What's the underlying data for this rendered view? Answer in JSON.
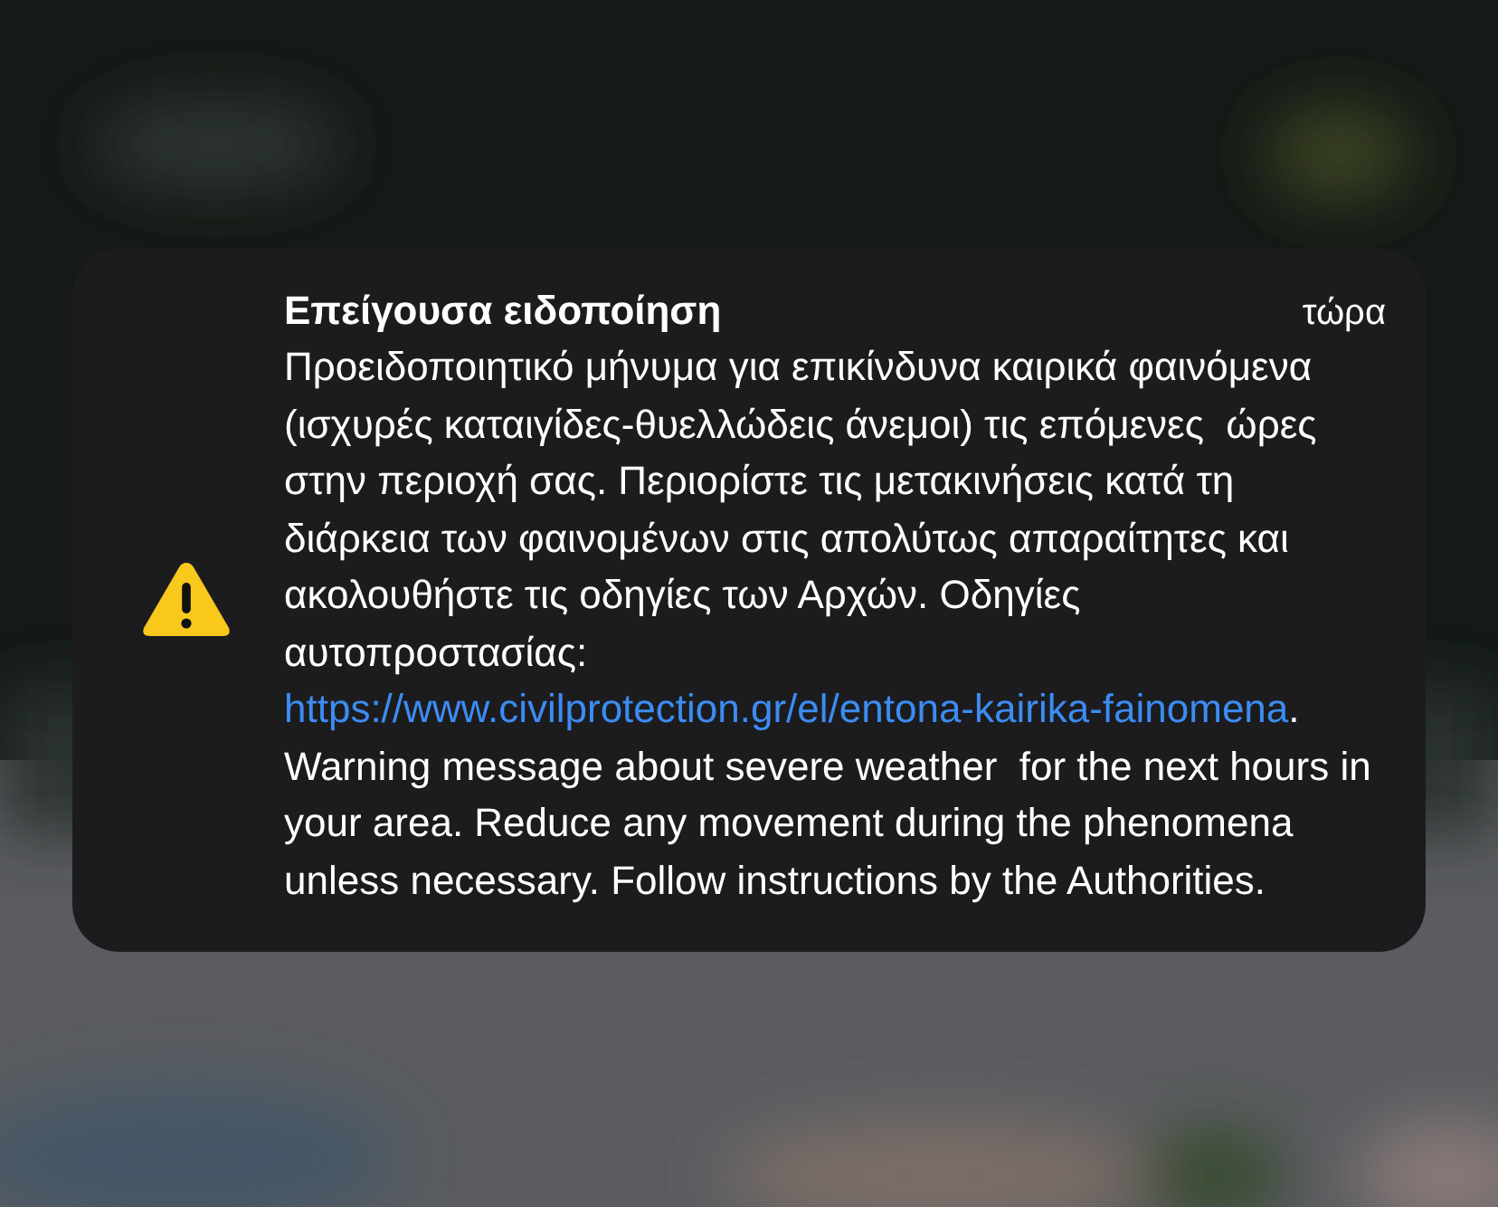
{
  "notification": {
    "title": "Επείγουσα ειδοποίηση",
    "time": "τώρα",
    "body_before_link": "Προειδοποιητικό μήνυμα για επικίνδυνα καιρικά φαινόμενα (ισχυρές καταιγίδες-θυελλώδεις άνεμοι) τις επόμενες  ώρες στην περιοχή σας. Περιορίστε τις μετακινήσεις κατά τη διάρκεια των φαινομένων στις απολύτως απαραίτητες και ακολουθήστε τις οδηγίες των Αρχών. Οδηγίες αυτοπροστασίας: ",
    "link": "https://www.civilprotection.gr/el/entona-kairika-fainomena",
    "body_after_link": ". Warning message about severe weather  for the next hours in your area. Reduce any movement during the phenomena unless necessary. Follow instructions by the Authorities."
  }
}
